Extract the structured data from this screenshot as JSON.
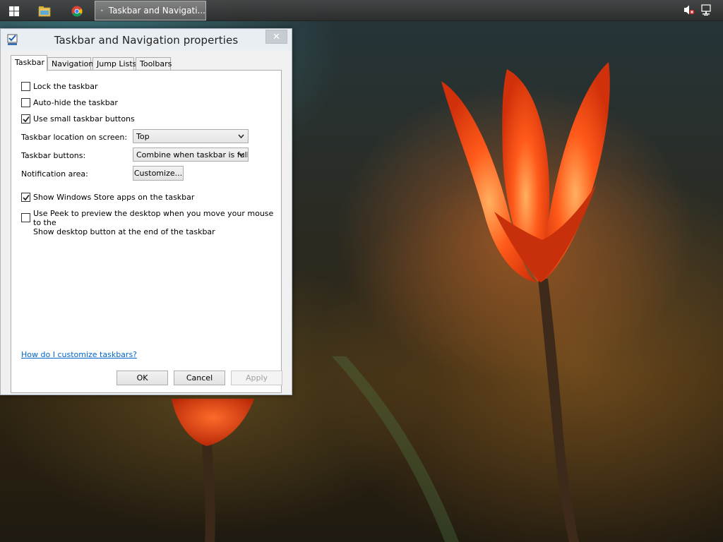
{
  "taskbar": {
    "task_button_label": "Taskbar and Navigati...",
    "icons": [
      "windows-logo-icon",
      "file-explorer-icon",
      "chrome-icon",
      "taskbar-properties-icon",
      "volume-muted-icon",
      "network-icon"
    ]
  },
  "dialog": {
    "title": "Taskbar and Navigation properties",
    "close_label": "✕",
    "tabs": [
      {
        "label": "Taskbar",
        "active": true
      },
      {
        "label": "Navigation",
        "active": false
      },
      {
        "label": "Jump Lists",
        "active": false
      },
      {
        "label": "Toolbars",
        "active": false
      }
    ],
    "checkboxes": {
      "lock_taskbar": {
        "label": "Lock the taskbar",
        "checked": false
      },
      "auto_hide": {
        "label": "Auto-hide the taskbar",
        "checked": false
      },
      "small_buttons": {
        "label": "Use small taskbar buttons",
        "checked": true
      },
      "store_apps": {
        "label": "Show Windows Store apps on the taskbar",
        "checked": true
      },
      "peek": {
        "label_line1": "Use Peek to preview the desktop when you move your mouse to the",
        "label_line2": "Show desktop button at the end of the taskbar",
        "checked": false
      }
    },
    "location": {
      "label": "Taskbar location on screen:",
      "value": "Top"
    },
    "buttons_setting": {
      "label": "Taskbar buttons:",
      "value": "Combine when taskbar is full"
    },
    "notification": {
      "label": "Notification area:",
      "button": "Customize..."
    },
    "help_link": "How do I customize taskbars?",
    "footer": {
      "ok": "OK",
      "cancel": "Cancel",
      "apply": "Apply"
    }
  },
  "colors": {
    "link": "#0066cc",
    "panel_border": "#adadad",
    "dialog_bg": "#f0f0f0"
  }
}
